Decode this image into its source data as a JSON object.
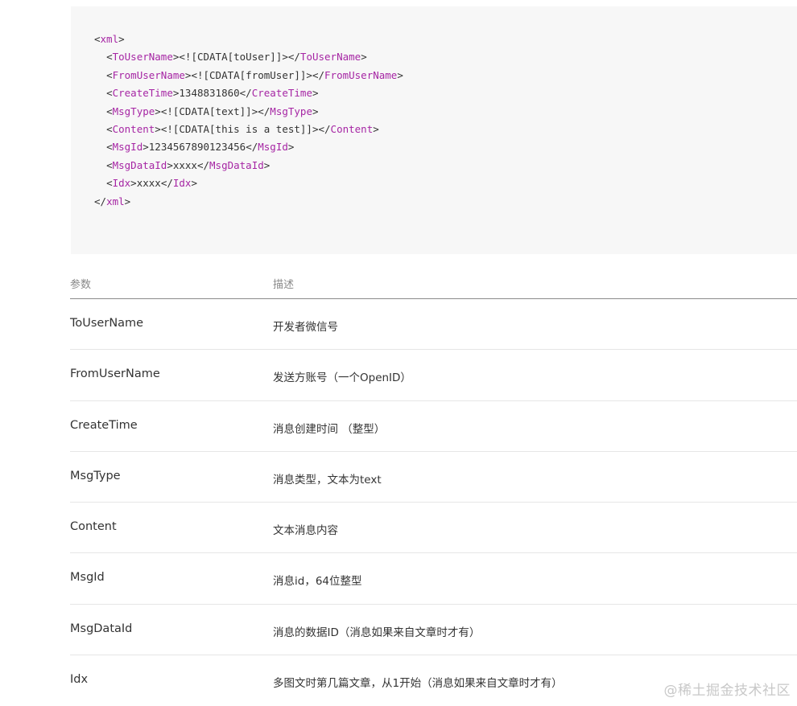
{
  "code": {
    "lines": [
      {
        "indent": "",
        "open": "<",
        "tag": "xml",
        "close": ">",
        "content": "",
        "end_open": "",
        "end_tag": "",
        "end_close": ""
      },
      {
        "indent": "  ",
        "open": "<",
        "tag": "ToUserName",
        "close": ">",
        "content": "<![CDATA[toUser]]>",
        "end_open": "</",
        "end_tag": "ToUserName",
        "end_close": ">"
      },
      {
        "indent": "  ",
        "open": "<",
        "tag": "FromUserName",
        "close": ">",
        "content": "<![CDATA[fromUser]]>",
        "end_open": "</",
        "end_tag": "FromUserName",
        "end_close": ">"
      },
      {
        "indent": "  ",
        "open": "<",
        "tag": "CreateTime",
        "close": ">",
        "content": "1348831860",
        "end_open": "</",
        "end_tag": "CreateTime",
        "end_close": ">"
      },
      {
        "indent": "  ",
        "open": "<",
        "tag": "MsgType",
        "close": ">",
        "content": "<![CDATA[text]]>",
        "end_open": "</",
        "end_tag": "MsgType",
        "end_close": ">"
      },
      {
        "indent": "  ",
        "open": "<",
        "tag": "Content",
        "close": ">",
        "content": "<![CDATA[this is a test]]>",
        "end_open": "</",
        "end_tag": "Content",
        "end_close": ">"
      },
      {
        "indent": "  ",
        "open": "<",
        "tag": "MsgId",
        "close": ">",
        "content": "1234567890123456",
        "end_open": "</",
        "end_tag": "MsgId",
        "end_close": ">"
      },
      {
        "indent": "  ",
        "open": "<",
        "tag": "MsgDataId",
        "close": ">",
        "content": "xxxx",
        "end_open": "</",
        "end_tag": "MsgDataId",
        "end_close": ">"
      },
      {
        "indent": "  ",
        "open": "<",
        "tag": "Idx",
        "close": ">",
        "content": "xxxx",
        "end_open": "</",
        "end_tag": "Idx",
        "end_close": ">"
      },
      {
        "indent": "",
        "open": "</",
        "tag": "xml",
        "close": ">",
        "content": "",
        "end_open": "",
        "end_tag": "",
        "end_close": ""
      }
    ]
  },
  "table": {
    "headers": {
      "param": "参数",
      "desc": "描述"
    },
    "rows": [
      {
        "param": "ToUserName",
        "desc": "开发者微信号"
      },
      {
        "param": "FromUserName",
        "desc": "发送方账号（一个OpenID）"
      },
      {
        "param": "CreateTime",
        "desc": "消息创建时间 （整型）"
      },
      {
        "param": "MsgType",
        "desc": "消息类型，文本为text"
      },
      {
        "param": "Content",
        "desc": "文本消息内容"
      },
      {
        "param": "MsgId",
        "desc": "消息id，64位整型"
      },
      {
        "param": "MsgDataId",
        "desc": "消息的数据ID（消息如果来自文章时才有）"
      },
      {
        "param": "Idx",
        "desc": "多图文时第几篇文章，从1开始（消息如果来自文章时才有）"
      }
    ]
  },
  "watermark": "@稀土掘金技术社区"
}
